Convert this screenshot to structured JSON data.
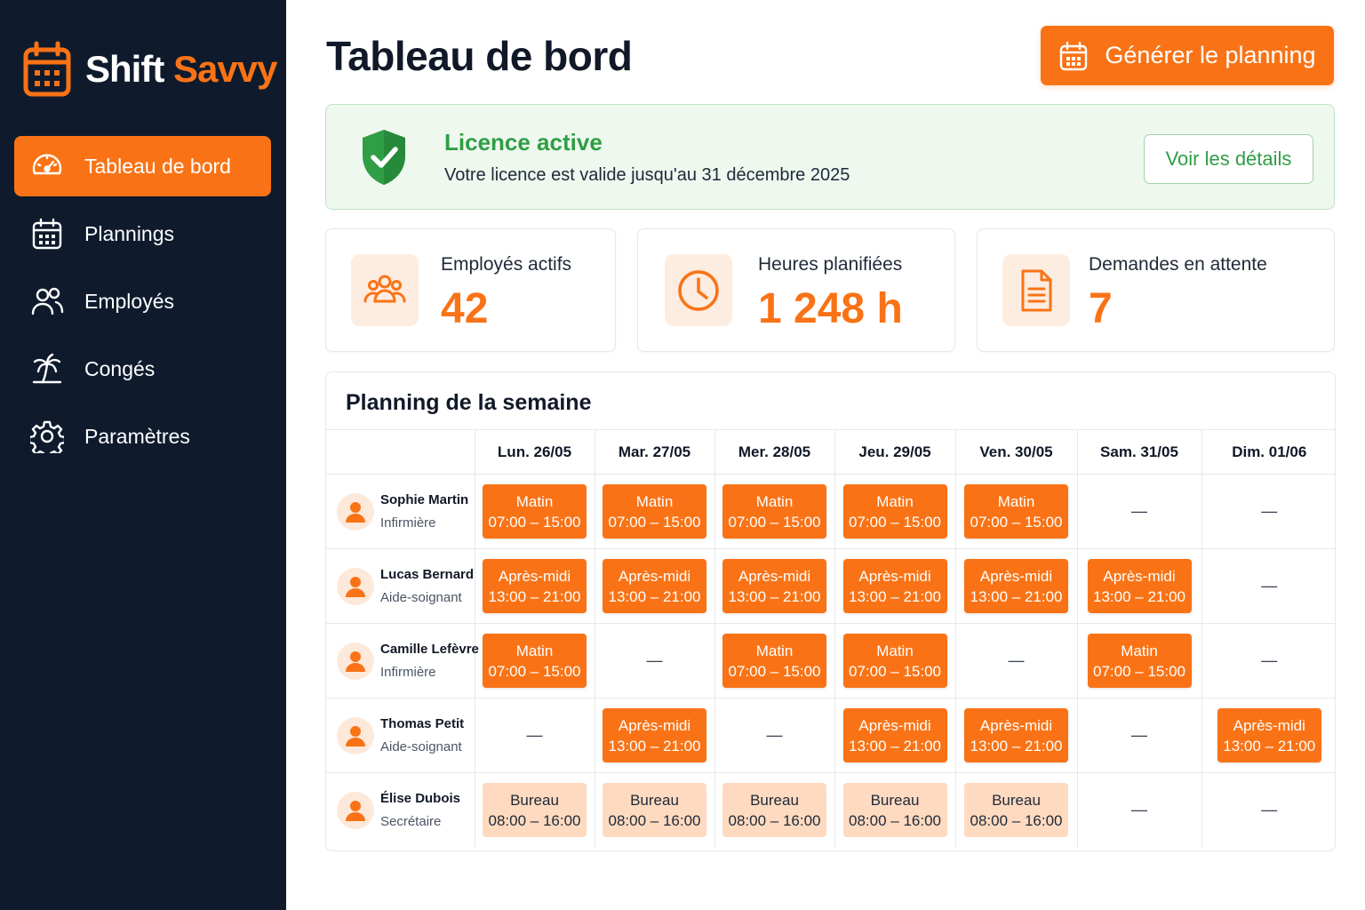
{
  "brand": {
    "name_part1": "Shift",
    "name_part2": "Savvy",
    "accent": "#f97316",
    "sidebar_bg": "#0f1b2d"
  },
  "sidebar": {
    "items": [
      {
        "label": "Tableau de bord",
        "icon": "dashboard-gauge-icon",
        "active": true
      },
      {
        "label": "Plannings",
        "icon": "calendar-icon",
        "active": false
      },
      {
        "label": "Employés",
        "icon": "users-icon",
        "active": false
      },
      {
        "label": "Congés",
        "icon": "palm-tree-icon",
        "active": false
      },
      {
        "label": "Paramètres",
        "icon": "gear-icon",
        "active": false
      }
    ]
  },
  "header": {
    "title": "Tableau de bord",
    "generate_button": "Générer le planning"
  },
  "license": {
    "title": "Licence active",
    "message": "Votre licence est valide jusqu'au 31 décembre 2025",
    "details_button": "Voir les détails",
    "status_color": "#2f9e44"
  },
  "stats": [
    {
      "label": "Employés actifs",
      "value": "42",
      "icon": "users-icon"
    },
    {
      "label": "Heures planifiées",
      "value": "1 248 h",
      "icon": "clock-icon"
    },
    {
      "label": "Demandes en attente",
      "value": "7",
      "icon": "document-icon"
    }
  ],
  "planning": {
    "title": "Planning de la semaine",
    "days": [
      "Lun. 26/05",
      "Mar. 27/05",
      "Mer. 28/05",
      "Jeu. 29/05",
      "Ven. 30/05",
      "Sam. 31/05",
      "Dim. 01/06"
    ],
    "empty_symbol": "—",
    "rows": [
      {
        "name": "Sophie Martin",
        "role": "Infirmière",
        "shifts": [
          {
            "type": "matin",
            "label": "Matin",
            "time": "07:00 – 15:00"
          },
          {
            "type": "matin",
            "label": "Matin",
            "time": "07:00 – 15:00"
          },
          {
            "type": "matin",
            "label": "Matin",
            "time": "07:00 – 15:00"
          },
          {
            "type": "matin",
            "label": "Matin",
            "time": "07:00 – 15:00"
          },
          {
            "type": "matin",
            "label": "Matin",
            "time": "07:00 – 15:00"
          },
          null,
          null
        ]
      },
      {
        "name": "Lucas Bernard",
        "role": "Aide-soignant",
        "shifts": [
          {
            "type": "apm",
            "label": "Après-midi",
            "time": "13:00 – 21:00"
          },
          {
            "type": "apm",
            "label": "Après-midi",
            "time": "13:00 – 21:00"
          },
          {
            "type": "apm",
            "label": "Après-midi",
            "time": "13:00 – 21:00"
          },
          {
            "type": "apm",
            "label": "Après-midi",
            "time": "13:00 – 21:00"
          },
          {
            "type": "apm",
            "label": "Après-midi",
            "time": "13:00 – 21:00"
          },
          {
            "type": "apm",
            "label": "Après-midi",
            "time": "13:00 – 21:00"
          },
          null
        ]
      },
      {
        "name": "Camille Lefèvre",
        "role": "Infirmière",
        "shifts": [
          {
            "type": "matin",
            "label": "Matin",
            "time": "07:00 – 15:00"
          },
          null,
          {
            "type": "matin",
            "label": "Matin",
            "time": "07:00 – 15:00"
          },
          {
            "type": "matin",
            "label": "Matin",
            "time": "07:00 – 15:00"
          },
          null,
          {
            "type": "matin",
            "label": "Matin",
            "time": "07:00 – 15:00"
          },
          null
        ]
      },
      {
        "name": "Thomas Petit",
        "role": "Aide-soignant",
        "shifts": [
          null,
          {
            "type": "apm",
            "label": "Après-midi",
            "time": "13:00 – 21:00"
          },
          null,
          {
            "type": "apm",
            "label": "Après-midi",
            "time": "13:00 – 21:00"
          },
          {
            "type": "apm",
            "label": "Après-midi",
            "time": "13:00 – 21:00"
          },
          null,
          {
            "type": "apm",
            "label": "Après-midi",
            "time": "13:00 – 21:00"
          }
        ]
      },
      {
        "name": "Élise Dubois",
        "role": "Secrétaire",
        "shifts": [
          {
            "type": "bureau",
            "label": "Bureau",
            "time": "08:00 – 16:00"
          },
          {
            "type": "bureau",
            "label": "Bureau",
            "time": "08:00 – 16:00"
          },
          {
            "type": "bureau",
            "label": "Bureau",
            "time": "08:00 – 16:00"
          },
          {
            "type": "bureau",
            "label": "Bureau",
            "time": "08:00 – 16:00"
          },
          {
            "type": "bureau",
            "label": "Bureau",
            "time": "08:00 – 16:00"
          },
          null,
          null
        ]
      }
    ]
  }
}
